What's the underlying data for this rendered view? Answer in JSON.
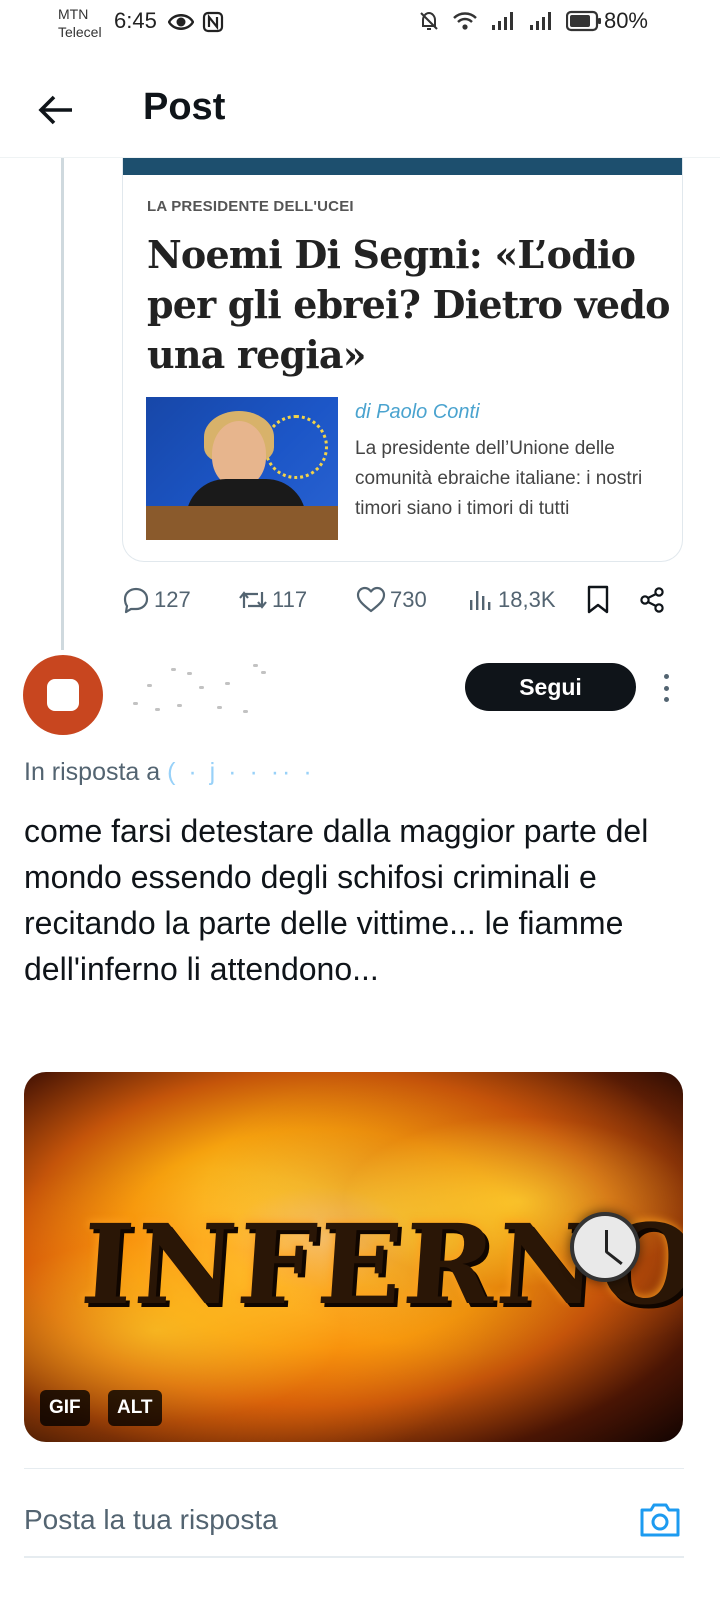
{
  "status_bar": {
    "carrier_line1": "MTN",
    "carrier_line2": "Telecel",
    "time": "6:45",
    "battery": "80%",
    "icons": [
      "eye-icon",
      "nfc-icon",
      "mute-bell-icon",
      "wifi-icon",
      "signal-icon",
      "signal-icon",
      "battery-icon"
    ]
  },
  "header": {
    "title": "Post",
    "back_icon": "arrow-left-icon"
  },
  "article_card": {
    "kicker": "LA PRESIDENTE DELL'UCEI",
    "headline": "Noemi Di Segni: «L’odio per gli ebrei? Dietro vedo una regia»",
    "byline": "di Paolo Conti",
    "summary": "La presidente dell’Unione delle comunità ebraiche italiane: i nostri timori siano i timori di tutti"
  },
  "actions": {
    "replies": "127",
    "reposts": "117",
    "likes": "730",
    "views": "18,3K",
    "icons": [
      "reply-icon",
      "repost-icon",
      "like-icon",
      "views-icon",
      "bookmark-icon",
      "share-icon"
    ]
  },
  "reply": {
    "follow_label": "Segui",
    "reply_to_prefix": "In risposta a",
    "reply_to_handle": "( · j ·  · ·· ·",
    "text": "come farsi detestare dalla maggior parte del mondo essendo degli schifosi criminali e recitando la parte delle vittime... le fiamme dell'inferno li attendono...",
    "media": {
      "word": "INFERNO",
      "badge_gif": "GIF",
      "badge_alt": "ALT"
    }
  },
  "composer": {
    "placeholder": "Posta la tua risposta",
    "camera_icon": "camera-icon"
  },
  "colors": {
    "accent": "#1d9bf0",
    "text": "#0f1419",
    "muted": "#536471",
    "avatar": "#c8461f",
    "card_bar": "#1d4f6e"
  }
}
